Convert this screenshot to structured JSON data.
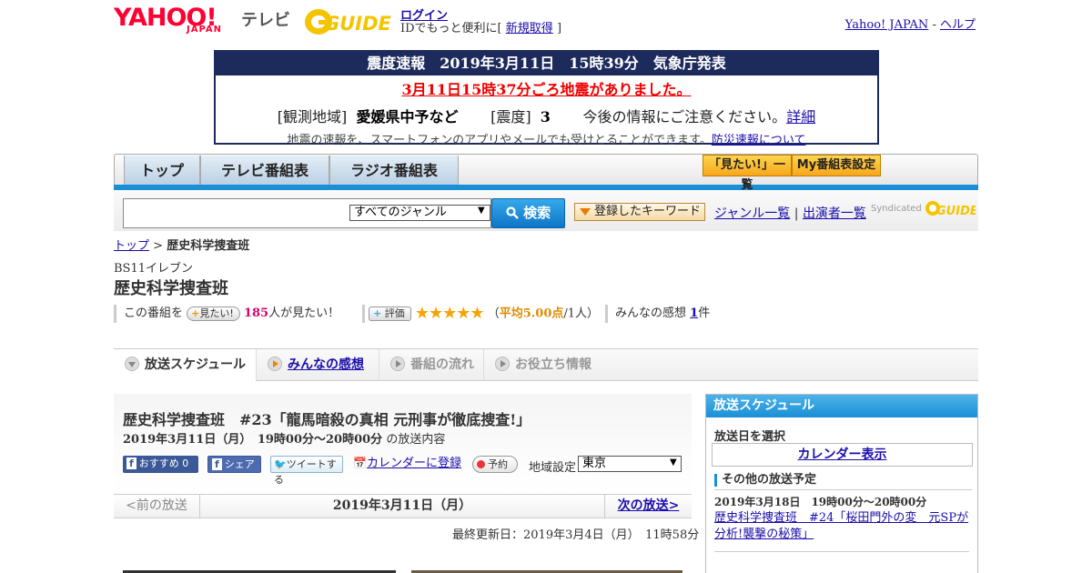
{
  "header": {
    "yahoo_logo": "YAHOO!",
    "yahoo_japan": "JAPAN",
    "tv_label": "テレビ",
    "gguide_logo": "G-GUIDE",
    "login": "ログイン",
    "id_prefix": "IDでもっと便利に[",
    "new_signup": "新規取得",
    "id_suffix": "]",
    "yahoo_japan_link": "Yahoo! JAPAN",
    "sep": "-",
    "help": "ヘルプ"
  },
  "earthquake": {
    "header": "震度速報　2019年3月11日　15時39分　気象庁発表",
    "alert": "3月11日15時37分ごろ地震がありました。",
    "region_label": "[観測地域]",
    "region_value": "愛媛県中予など",
    "intensity_label": "[震度]",
    "intensity_value": "3",
    "caution": "今後の情報にご注意ください。",
    "detail_link": "詳細",
    "note": "地震の速報を、スマートフォンのアプリやメールでも受けとることができます。",
    "note_link": "防災速報について"
  },
  "nav": {
    "tabs": [
      "トップ",
      "テレビ番組表",
      "ラジオ番組表"
    ],
    "want_list": "「見たい!」一覧",
    "my_schedule": "My番組表設定"
  },
  "search": {
    "genre_select": "すべてのジャンル",
    "search_btn": "検索",
    "keyword_btn": "登録したキーワード",
    "genre_list": "ジャンル一覧",
    "sep": "|",
    "performer_list": "出演者一覧",
    "syndicated": "Syndicated"
  },
  "breadcrumb": {
    "top": "トップ",
    "sep": ">",
    "current": "歴史科学捜査班"
  },
  "program": {
    "station": "BS11イレブン",
    "title": "歴史科学捜査班",
    "want_prefix": "この番組を",
    "want_btn": "見たい!",
    "want_count": "185",
    "want_suffix": "人が見たい！",
    "rating_btn": "評価",
    "stars": "★★★★★",
    "rating_open": "（",
    "rating_avg": "平均5.00点",
    "rating_count": "/1人）",
    "comments_label": "みんなの感想",
    "comments_count": "1",
    "comments_suffix": "件"
  },
  "content_tabs": [
    "放送スケジュール",
    "みんなの感想",
    "番組の流れ",
    "お役立ち情報"
  ],
  "episode": {
    "title": "歴史科学捜査班　#23「龍馬暗殺の真相 元刑事が徹底捜査!」",
    "datetime": "2019年3月11日（月）　19時00分～20時00分",
    "datetime_suffix": "の放送内容",
    "recommend": "おすすめ",
    "recommend_count": "0",
    "share": "シェア",
    "tweet": "ツイートする",
    "calendar_register": "カレンダーに登録",
    "reserve": "予約",
    "region_label": "地域設定",
    "region_value": "東京",
    "prev": "<前の放送",
    "current_date": "2019年3月11日（月）",
    "next": "次の放送>",
    "updated": "最終更新日：2019年3月4日（月）　11時58分"
  },
  "sidebar": {
    "title": "放送スケジュール",
    "date_select": "放送日を選択",
    "calendar_btn": "カレンダー表示",
    "other_schedule": "その他の放送予定",
    "other_date": "2019年3月18日　19時00分～20時00分",
    "other_title": "歴史科学捜査班　#24「桜田門外の変　元SPが分析!襲撃の秘策」"
  }
}
